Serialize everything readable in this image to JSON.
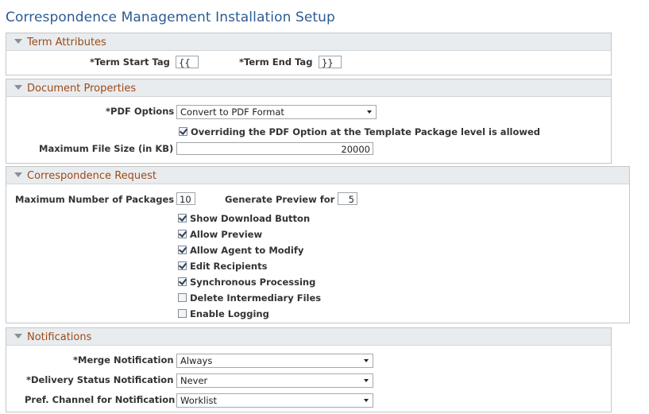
{
  "page_title": "Correspondence Management Installation Setup",
  "term_attributes": {
    "title": "Term Attributes",
    "start_tag_label": "*Term Start Tag",
    "start_tag_value": "{{",
    "end_tag_label": "*Term End Tag",
    "end_tag_value": "}}"
  },
  "document_properties": {
    "title": "Document Properties",
    "pdf_options_label": "*PDF Options",
    "pdf_options_value": "Convert to PDF Format",
    "override_label": "Overriding the PDF Option at the Template Package level is allowed",
    "override_checked": true,
    "max_file_size_label": "Maximum File Size (in KB)",
    "max_file_size_value": "20000"
  },
  "correspondence_request": {
    "title": "Correspondence Request",
    "max_packages_label": "Maximum Number of Packages",
    "max_packages_value": "10",
    "generate_preview_label": "Generate Preview for",
    "generate_preview_value": "5",
    "options": [
      {
        "label": "Show Download Button",
        "checked": true
      },
      {
        "label": "Allow Preview",
        "checked": true
      },
      {
        "label": "Allow Agent to Modify",
        "checked": true
      },
      {
        "label": "Edit Recipients",
        "checked": true
      },
      {
        "label": "Synchronous Processing",
        "checked": true
      },
      {
        "label": "Delete Intermediary Files",
        "checked": false
      },
      {
        "label": "Enable Logging",
        "checked": false
      }
    ]
  },
  "notifications": {
    "title": "Notifications",
    "merge_label": "*Merge Notification",
    "merge_value": "Always",
    "delivery_label": "*Delivery Status Notification",
    "delivery_value": "Never",
    "channel_label": "Pref. Channel for Notification",
    "channel_value": "Worklist"
  }
}
